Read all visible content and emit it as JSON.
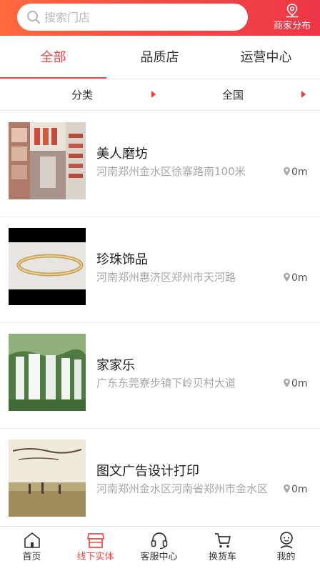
{
  "header": {
    "search_placeholder": "搜索门店",
    "merchant_distribution": "商家分布",
    "accent_color": "#f04a48"
  },
  "tabs": [
    {
      "label": "全部",
      "active": true
    },
    {
      "label": "品质店",
      "active": false
    },
    {
      "label": "运营中心",
      "active": false
    }
  ],
  "filters": [
    {
      "label": "分类"
    },
    {
      "label": "全国"
    }
  ],
  "stores": [
    {
      "name": "美人磨坊",
      "address": "河南郑州金水区徐寨路南100米",
      "distance": "0m",
      "thumb": "shop-interior-photo"
    },
    {
      "name": "珍珠饰品",
      "address": "河南郑州惠济区郑州市天河路",
      "distance": "0m",
      "thumb": "bracelet-photo"
    },
    {
      "name": "家家乐",
      "address": "广东东莞寮步镇下岭贝村大道",
      "distance": "0m",
      "thumb": "waterfall-photo"
    },
    {
      "name": "图文广告设计打印",
      "address": "河南郑州金水区河南省郑州市金水区",
      "distance": "0m",
      "thumb": "field-people-photo"
    }
  ],
  "bottom_nav": [
    {
      "label": "首页",
      "icon": "home-icon",
      "active": false
    },
    {
      "label": "线下实体",
      "icon": "store-icon",
      "active": true
    },
    {
      "label": "客服中心",
      "icon": "headset-icon",
      "active": false
    },
    {
      "label": "换货车",
      "icon": "cart-icon",
      "active": false
    },
    {
      "label": "我的",
      "icon": "profile-icon",
      "active": false
    }
  ]
}
